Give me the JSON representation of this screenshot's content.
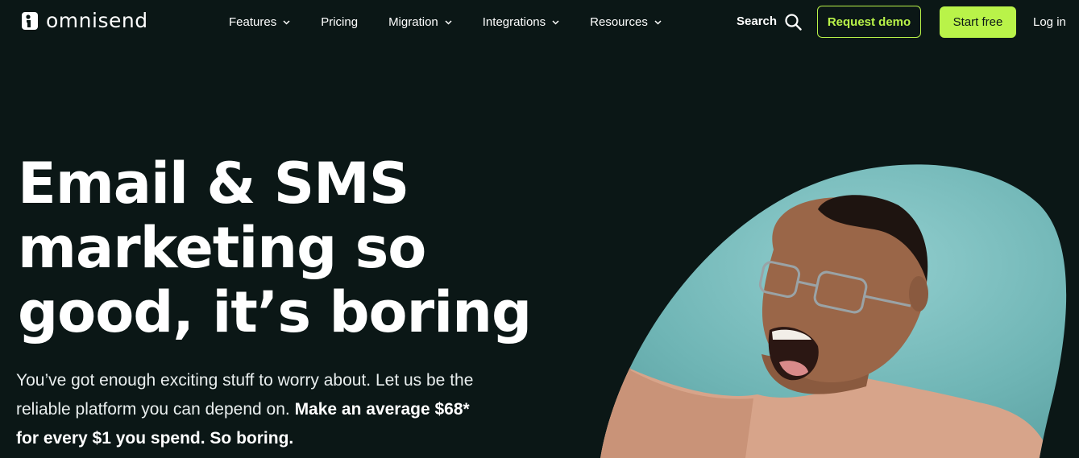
{
  "brand": {
    "name": "omnisend"
  },
  "nav": {
    "items": [
      {
        "label": "Features",
        "has_dropdown": true
      },
      {
        "label": "Pricing",
        "has_dropdown": false
      },
      {
        "label": "Migration",
        "has_dropdown": true
      },
      {
        "label": "Integrations",
        "has_dropdown": true
      },
      {
        "label": "Resources",
        "has_dropdown": true
      }
    ],
    "search_label": "Search",
    "request_demo_label": "Request demo",
    "start_free_label": "Start free",
    "login_label": "Log in"
  },
  "hero": {
    "title_lines": [
      "Email & SMS",
      "marketing so",
      "good, it’s boring"
    ],
    "subtitle_plain": "You’ve got enough exciting stuff to worry about. Let us be the reliable platform you can depend on. ",
    "subtitle_bold": "Make an average $68* for every $1 you spend. So boring."
  },
  "colors": {
    "background": "#0b1716",
    "accent": "#b9f349",
    "photo_bg": "#6cb3b3"
  },
  "icons": {
    "logo": "omnisend-logo-icon",
    "search": "search-icon",
    "dropdown": "chevron-down-icon"
  }
}
